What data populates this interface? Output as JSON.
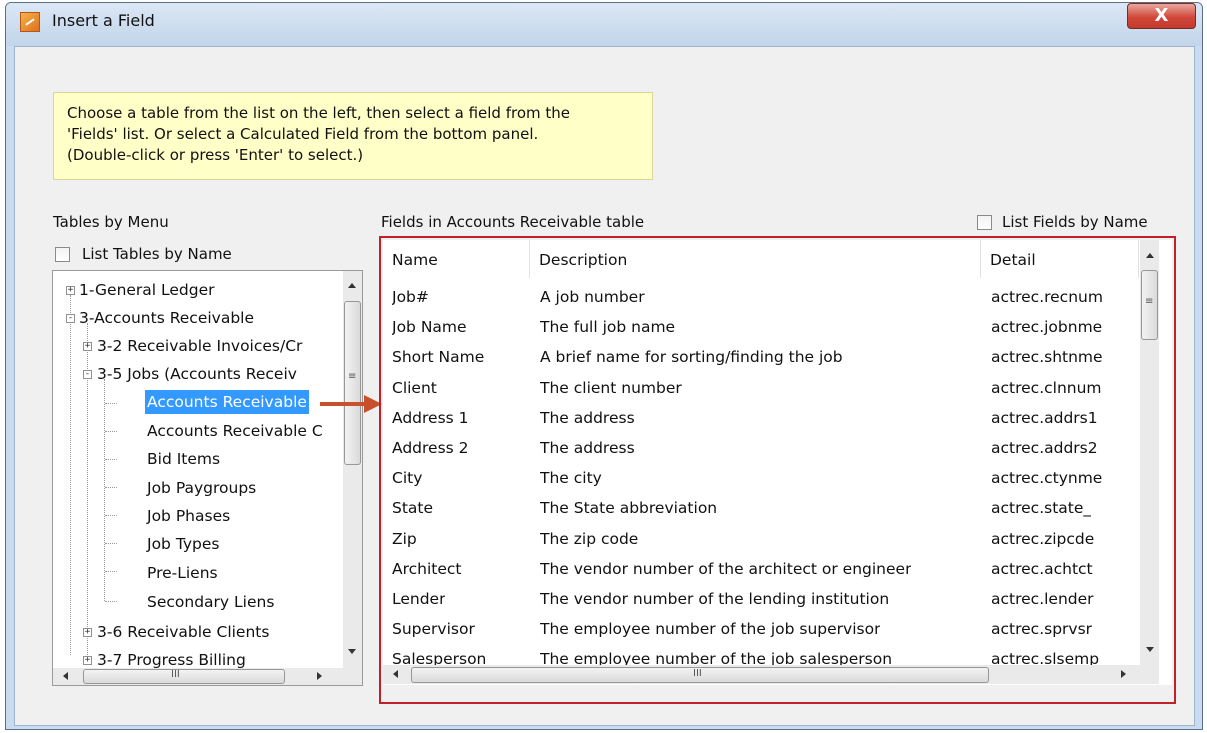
{
  "window": {
    "title": "Insert a Field",
    "close_label": "X"
  },
  "hint": {
    "lines": [
      "Choose a table from the list on the left, then select a field from the",
      "'Fields' list.  Or select a Calculated Field from the bottom panel.",
      "(Double-click or press 'Enter' to select.)"
    ]
  },
  "left": {
    "section_label": "Tables by Menu",
    "list_by_name_label": "List Tables by Name",
    "list_by_name_checked": false,
    "tree": [
      {
        "label": "1-General Ledger",
        "expander": "+"
      },
      {
        "label": "3-Accounts Receivable",
        "expander": "-"
      },
      {
        "label": "3-2 Receivable Invoices/Cr",
        "expander": "+"
      },
      {
        "label": "3-5 Jobs (Accounts Receiv",
        "expander": "-"
      },
      {
        "label": "Accounts Receivable",
        "selected": true
      },
      {
        "label": "Accounts Receivable C"
      },
      {
        "label": "Bid Items"
      },
      {
        "label": "Job Paygroups"
      },
      {
        "label": "Job Phases"
      },
      {
        "label": "Job Types"
      },
      {
        "label": "Pre-Liens"
      },
      {
        "label": "Secondary Liens"
      },
      {
        "label": "3-6 Receivable Clients",
        "expander": "+"
      },
      {
        "label": "3-7 Progress Billing",
        "expander": "+"
      }
    ],
    "scrollbar_grip": "III"
  },
  "right": {
    "section_label": "Fields in Accounts Receivable table",
    "list_by_name_label": "List Fields by Name",
    "list_by_name_checked": false,
    "columns": [
      "Name",
      "Description",
      "Detail"
    ],
    "rows": [
      {
        "name": "Job#",
        "description": "A job number",
        "detail": "actrec.recnum"
      },
      {
        "name": "Job Name",
        "description": "The full job name",
        "detail": "actrec.jobnme"
      },
      {
        "name": "Short Name",
        "description": "A brief name for sorting/finding the job",
        "detail": "actrec.shtnme"
      },
      {
        "name": "Client",
        "description": "The client number",
        "detail": "actrec.clnnum"
      },
      {
        "name": "Address 1",
        "description": "The address",
        "detail": "actrec.addrs1"
      },
      {
        "name": "Address 2",
        "description": "The address",
        "detail": "actrec.addrs2"
      },
      {
        "name": "City",
        "description": "The city",
        "detail": "actrec.ctynme"
      },
      {
        "name": "State",
        "description": "The State abbreviation",
        "detail": "actrec.state_"
      },
      {
        "name": "Zip",
        "description": "The zip code",
        "detail": "actrec.zipcde"
      },
      {
        "name": "Architect",
        "description": "The vendor number of the architect or engineer",
        "detail": "actrec.achtct"
      },
      {
        "name": "Lender",
        "description": "The vendor number of the lending institution",
        "detail": "actrec.lender"
      },
      {
        "name": "Supervisor",
        "description": "The employee number of the job supervisor",
        "detail": "actrec.sprvsr"
      },
      {
        "name": "Salesperson",
        "description": "The employee number of the job salesperson",
        "detail": "actrec.slsemp"
      }
    ],
    "scrollbar_grip": "III"
  },
  "colors": {
    "selection": "#3399ff",
    "highlight_frame": "#c0202a",
    "arrow": "#c8502a",
    "hint_bg": "#ffffc8"
  }
}
